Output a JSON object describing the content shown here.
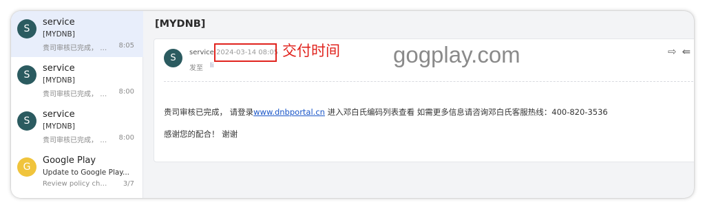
{
  "messages": [
    {
      "avatar": "S",
      "avatar_color": "#2b5b60",
      "sender": "service",
      "subject": "[MYDNB]",
      "preview": "贵司审核已完成， 请...",
      "time": "8:05",
      "active": true
    },
    {
      "avatar": "S",
      "avatar_color": "#2b5b60",
      "sender": "service",
      "subject": "[MYDNB]",
      "preview": "贵司审核已完成， 请...",
      "time": "8:00",
      "active": false
    },
    {
      "avatar": "S",
      "avatar_color": "#2b5b60",
      "sender": "service",
      "subject": "[MYDNB]",
      "preview": "贵司审核已完成， 请...",
      "time": "8:00",
      "active": false
    },
    {
      "avatar": "G",
      "avatar_color": "#f0c43c",
      "sender": "Google Play",
      "subject": "Update to Google Play...",
      "preview": "Review policy chang...",
      "time": "3/7",
      "active": false
    }
  ],
  "mail": {
    "title": "[MYDNB]",
    "avatar": "S",
    "from": "service",
    "sent_time": "2024-03-14 08:05",
    "to_label": "发至",
    "to": "li",
    "body_prefix": "贵司审核已完成， 请登录",
    "body_link": "www.dnbportal.cn",
    "body_suffix": " 进入邓白氏编码列表查看 如需更多信息请咨询邓白氏客服热线：400-820-3536",
    "body_line2": "感谢您的配合！ 谢谢"
  },
  "annotation": {
    "label": "交付时间",
    "color": "#e0221c"
  },
  "watermark": "gogplay.com",
  "icons": {
    "forward": "forward-icon",
    "reply_all": "reply-all-icon"
  }
}
